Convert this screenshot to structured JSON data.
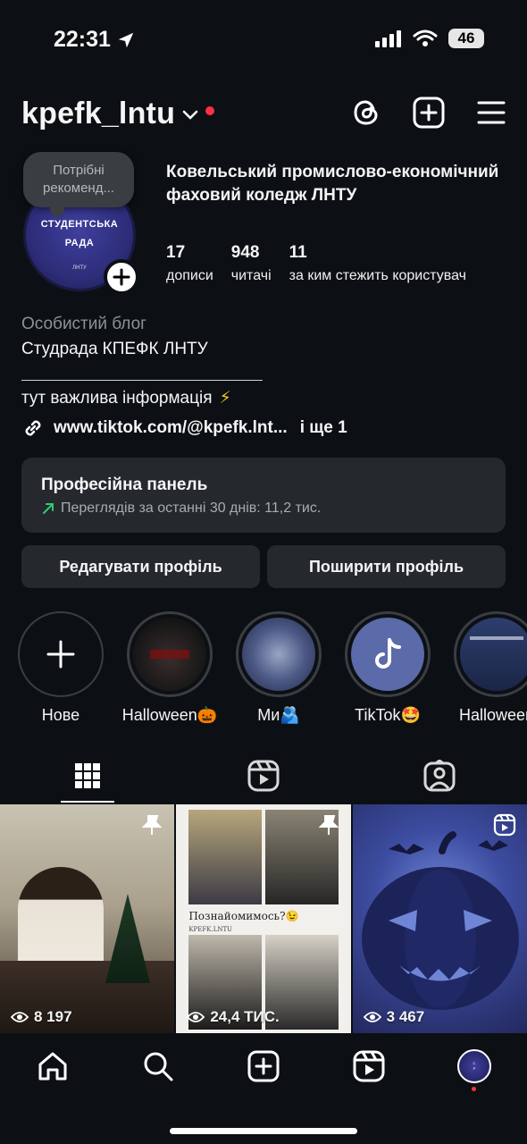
{
  "status_bar": {
    "time": "22:31",
    "battery": "46"
  },
  "header": {
    "username": "kpefk_lntu"
  },
  "profile": {
    "note": "Потрібні рекоменд...",
    "avatar_text": "СТУДЕНТСЬКА РАДА",
    "avatar_subtext": "ЛНТУ",
    "full_name": "Ковельський промислово-економічний фаховий коледж ЛНТУ",
    "stats": [
      {
        "value": "17",
        "label": "дописи"
      },
      {
        "value": "948",
        "label": "читачі"
      },
      {
        "value": "11",
        "label": "за ким стежить користувач"
      }
    ],
    "category": "Особистий блог",
    "bio_line1": "Студрада КПЕФК ЛНТУ",
    "bio_line2": "тут важлива інформація",
    "bio_emoji": "⚡",
    "link": "www.tiktok.com/@kpefk.lnt...",
    "link_more": "і ще 1"
  },
  "dashboard": {
    "title": "Професійна панель",
    "subtitle": "Переглядів за останні 30 днів: 11,2 тис."
  },
  "buttons": {
    "edit": "Редагувати профіль",
    "share": "Поширити профіль"
  },
  "highlights": [
    {
      "label": "Нове"
    },
    {
      "label": "Halloween🎃"
    },
    {
      "label": "Ми🫂"
    },
    {
      "label": "TikTok🤩"
    },
    {
      "label": "Halloween"
    }
  ],
  "grid": [
    {
      "views": "8 197",
      "pinned": true
    },
    {
      "views": "24,4 ТИС.",
      "pinned": true,
      "caption": "Познайомимось?😉",
      "caption_sub": "KPEFK.LNTU"
    },
    {
      "views": "3 467",
      "reel": true
    }
  ],
  "colors": {
    "background": "#0c1014",
    "panel": "#25292e",
    "accent_red": "#ff3040",
    "trend_green": "#2ecc71"
  }
}
